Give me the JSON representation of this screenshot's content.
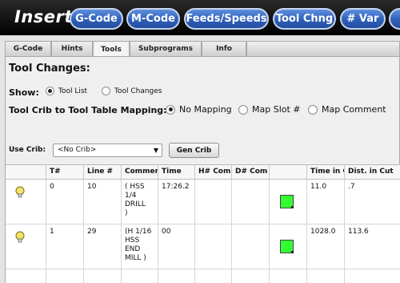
{
  "insert_bar": {
    "title": "Insert:",
    "buttons": [
      "G-Code",
      "M-Code",
      "Feeds/Speeds",
      "Tool Chng",
      "# Var"
    ]
  },
  "tabs": [
    "G-Code",
    "Hints",
    "Tools",
    "Subprograms",
    "Info"
  ],
  "active_tab": "Tools",
  "section_title": "Tool Changes:",
  "show": {
    "label": "Show:",
    "options": [
      "Tool List",
      "Tool Changes"
    ],
    "selected": "Tool List"
  },
  "mapping": {
    "label": "Tool Crib to Tool Table Mapping:",
    "options": [
      "No Mapping",
      "Map Slot #",
      "Map Comment"
    ],
    "selected": "No Mapping"
  },
  "use_crib": {
    "label": "Use Crib:",
    "selected": "<No Crib>",
    "button": "Gen Crib"
  },
  "table": {
    "columns": [
      "",
      "T#",
      "Line #",
      "Comment",
      "Time",
      "H# Com",
      "D# Com",
      "",
      "Time in Cut",
      "Dist. in Cut"
    ],
    "rows": [
      {
        "t": "0",
        "line": "10",
        "comment": "( HSS 1/4 DRILL )",
        "time": "17:26.2",
        "h": "",
        "d": "",
        "time_in_cut": "11.0",
        "dist_in_cut": ".7"
      },
      {
        "t": "1",
        "line": "29",
        "comment": "(H 1/16 HSS END MILL )",
        "time": "00",
        "h": "",
        "d": "",
        "time_in_cut": "1028.0",
        "dist_in_cut": "113.6"
      }
    ],
    "tool_color": "#33ff33"
  }
}
